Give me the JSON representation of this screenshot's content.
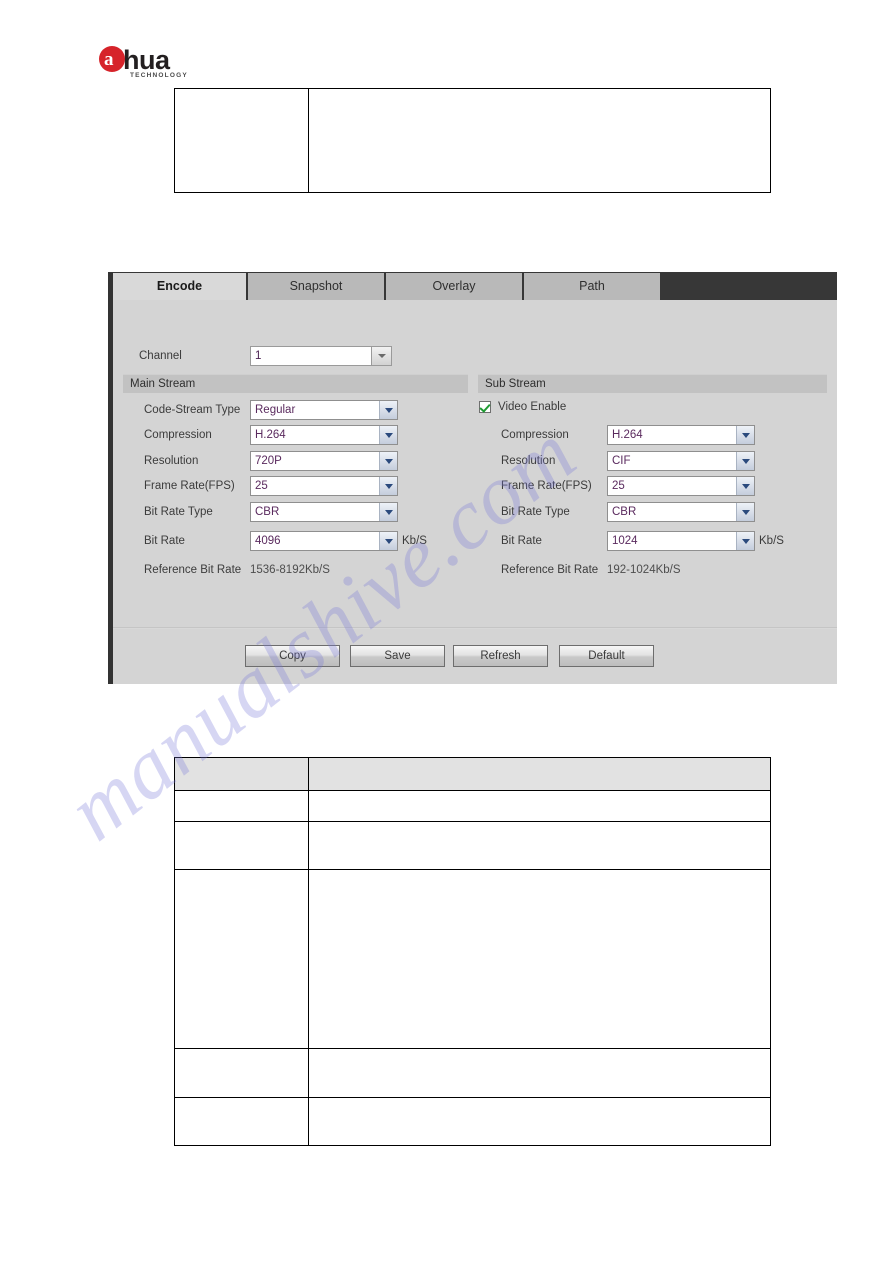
{
  "brand": {
    "logo_letter": "a",
    "logo_word": "hua",
    "logo_sub": "TECHNOLOGY"
  },
  "watermark": {
    "text": "manualshive.com"
  },
  "encode_panel": {
    "tabs": [
      {
        "label": "Encode",
        "active": true
      },
      {
        "label": "Snapshot",
        "active": false
      },
      {
        "label": "Overlay",
        "active": false
      },
      {
        "label": "Path",
        "active": false
      }
    ],
    "channel": {
      "label": "Channel",
      "value": "1"
    },
    "main_stream": {
      "title": "Main Stream",
      "fields": [
        {
          "label": "Code-Stream Type",
          "value": "Regular",
          "type": "select"
        },
        {
          "label": "Compression",
          "value": "H.264",
          "type": "select"
        },
        {
          "label": "Resolution",
          "value": "720P",
          "type": "select"
        },
        {
          "label": "Frame Rate(FPS)",
          "value": "25",
          "type": "select"
        },
        {
          "label": "Bit Rate Type",
          "value": "CBR",
          "type": "select"
        },
        {
          "label": "Bit Rate",
          "value": "4096",
          "type": "select",
          "unit": "Kb/S"
        },
        {
          "label": "Reference Bit Rate",
          "value": "1536-8192Kb/S",
          "type": "static"
        }
      ]
    },
    "sub_stream": {
      "title": "Sub Stream",
      "video_enable": {
        "label": "Video Enable",
        "checked": true
      },
      "fields": [
        {
          "label": "Compression",
          "value": "H.264",
          "type": "select"
        },
        {
          "label": "Resolution",
          "value": "CIF",
          "type": "select"
        },
        {
          "label": "Frame Rate(FPS)",
          "value": "25",
          "type": "select"
        },
        {
          "label": "Bit Rate Type",
          "value": "CBR",
          "type": "select"
        },
        {
          "label": "Bit Rate",
          "value": "1024",
          "type": "select",
          "unit": "Kb/S"
        },
        {
          "label": "Reference Bit Rate",
          "value": "192-1024Kb/S",
          "type": "static"
        }
      ]
    },
    "buttons": [
      {
        "label": "Copy"
      },
      {
        "label": "Save"
      },
      {
        "label": "Refresh"
      },
      {
        "label": "Default"
      }
    ]
  },
  "doc_tables": {
    "top": {
      "col1_width": 134,
      "rows": [
        {
          "height": 104,
          "header": false,
          "c1": "",
          "c2": ""
        }
      ]
    },
    "bottom": {
      "col1_width": 134,
      "rows": [
        {
          "height": 33,
          "header": true,
          "c1": "",
          "c2": ""
        },
        {
          "height": 31,
          "header": false,
          "c1": "",
          "c2": ""
        },
        {
          "height": 48,
          "header": false,
          "c1": "",
          "c2": ""
        },
        {
          "height": 179,
          "header": false,
          "c1": "",
          "c2": ""
        },
        {
          "height": 49,
          "header": false,
          "c1": "",
          "c2": ""
        },
        {
          "height": 48,
          "header": false,
          "c1": "",
          "c2": ""
        }
      ]
    }
  }
}
